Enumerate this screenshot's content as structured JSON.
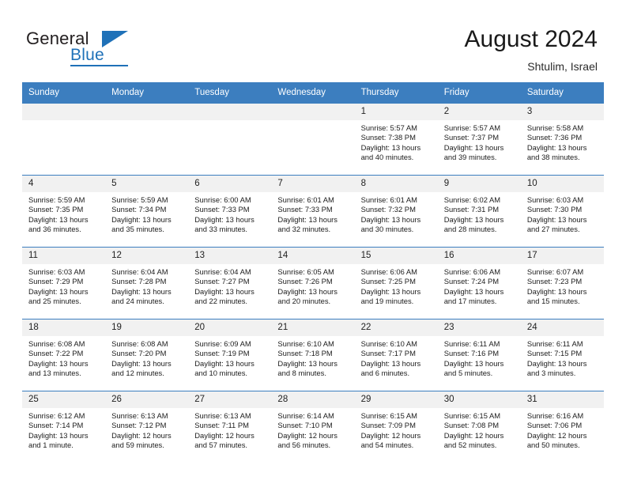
{
  "brand": {
    "name_part1": "General",
    "name_part2": "Blue",
    "accent_color": "#1f71b8"
  },
  "header": {
    "title": "August 2024",
    "location": "Shtulim, Israel"
  },
  "theme": {
    "header_row_color": "#3c7ebf",
    "daynum_bg": "#f1f1f1",
    "text_color": "#1c1c1c"
  },
  "weekdays": [
    "Sunday",
    "Monday",
    "Tuesday",
    "Wednesday",
    "Thursday",
    "Friday",
    "Saturday"
  ],
  "weeks": [
    [
      {
        "day": "",
        "blank": true
      },
      {
        "day": "",
        "blank": true
      },
      {
        "day": "",
        "blank": true
      },
      {
        "day": "",
        "blank": true
      },
      {
        "day": "1",
        "sunrise": "Sunrise: 5:57 AM",
        "sunset": "Sunset: 7:38 PM",
        "daylight_line1": "Daylight: 13 hours",
        "daylight_line2": "and 40 minutes."
      },
      {
        "day": "2",
        "sunrise": "Sunrise: 5:57 AM",
        "sunset": "Sunset: 7:37 PM",
        "daylight_line1": "Daylight: 13 hours",
        "daylight_line2": "and 39 minutes."
      },
      {
        "day": "3",
        "sunrise": "Sunrise: 5:58 AM",
        "sunset": "Sunset: 7:36 PM",
        "daylight_line1": "Daylight: 13 hours",
        "daylight_line2": "and 38 minutes."
      }
    ],
    [
      {
        "day": "4",
        "sunrise": "Sunrise: 5:59 AM",
        "sunset": "Sunset: 7:35 PM",
        "daylight_line1": "Daylight: 13 hours",
        "daylight_line2": "and 36 minutes."
      },
      {
        "day": "5",
        "sunrise": "Sunrise: 5:59 AM",
        "sunset": "Sunset: 7:34 PM",
        "daylight_line1": "Daylight: 13 hours",
        "daylight_line2": "and 35 minutes."
      },
      {
        "day": "6",
        "sunrise": "Sunrise: 6:00 AM",
        "sunset": "Sunset: 7:33 PM",
        "daylight_line1": "Daylight: 13 hours",
        "daylight_line2": "and 33 minutes."
      },
      {
        "day": "7",
        "sunrise": "Sunrise: 6:01 AM",
        "sunset": "Sunset: 7:33 PM",
        "daylight_line1": "Daylight: 13 hours",
        "daylight_line2": "and 32 minutes."
      },
      {
        "day": "8",
        "sunrise": "Sunrise: 6:01 AM",
        "sunset": "Sunset: 7:32 PM",
        "daylight_line1": "Daylight: 13 hours",
        "daylight_line2": "and 30 minutes."
      },
      {
        "day": "9",
        "sunrise": "Sunrise: 6:02 AM",
        "sunset": "Sunset: 7:31 PM",
        "daylight_line1": "Daylight: 13 hours",
        "daylight_line2": "and 28 minutes."
      },
      {
        "day": "10",
        "sunrise": "Sunrise: 6:03 AM",
        "sunset": "Sunset: 7:30 PM",
        "daylight_line1": "Daylight: 13 hours",
        "daylight_line2": "and 27 minutes."
      }
    ],
    [
      {
        "day": "11",
        "sunrise": "Sunrise: 6:03 AM",
        "sunset": "Sunset: 7:29 PM",
        "daylight_line1": "Daylight: 13 hours",
        "daylight_line2": "and 25 minutes."
      },
      {
        "day": "12",
        "sunrise": "Sunrise: 6:04 AM",
        "sunset": "Sunset: 7:28 PM",
        "daylight_line1": "Daylight: 13 hours",
        "daylight_line2": "and 24 minutes."
      },
      {
        "day": "13",
        "sunrise": "Sunrise: 6:04 AM",
        "sunset": "Sunset: 7:27 PM",
        "daylight_line1": "Daylight: 13 hours",
        "daylight_line2": "and 22 minutes."
      },
      {
        "day": "14",
        "sunrise": "Sunrise: 6:05 AM",
        "sunset": "Sunset: 7:26 PM",
        "daylight_line1": "Daylight: 13 hours",
        "daylight_line2": "and 20 minutes."
      },
      {
        "day": "15",
        "sunrise": "Sunrise: 6:06 AM",
        "sunset": "Sunset: 7:25 PM",
        "daylight_line1": "Daylight: 13 hours",
        "daylight_line2": "and 19 minutes."
      },
      {
        "day": "16",
        "sunrise": "Sunrise: 6:06 AM",
        "sunset": "Sunset: 7:24 PM",
        "daylight_line1": "Daylight: 13 hours",
        "daylight_line2": "and 17 minutes."
      },
      {
        "day": "17",
        "sunrise": "Sunrise: 6:07 AM",
        "sunset": "Sunset: 7:23 PM",
        "daylight_line1": "Daylight: 13 hours",
        "daylight_line2": "and 15 minutes."
      }
    ],
    [
      {
        "day": "18",
        "sunrise": "Sunrise: 6:08 AM",
        "sunset": "Sunset: 7:22 PM",
        "daylight_line1": "Daylight: 13 hours",
        "daylight_line2": "and 13 minutes."
      },
      {
        "day": "19",
        "sunrise": "Sunrise: 6:08 AM",
        "sunset": "Sunset: 7:20 PM",
        "daylight_line1": "Daylight: 13 hours",
        "daylight_line2": "and 12 minutes."
      },
      {
        "day": "20",
        "sunrise": "Sunrise: 6:09 AM",
        "sunset": "Sunset: 7:19 PM",
        "daylight_line1": "Daylight: 13 hours",
        "daylight_line2": "and 10 minutes."
      },
      {
        "day": "21",
        "sunrise": "Sunrise: 6:10 AM",
        "sunset": "Sunset: 7:18 PM",
        "daylight_line1": "Daylight: 13 hours",
        "daylight_line2": "and 8 minutes."
      },
      {
        "day": "22",
        "sunrise": "Sunrise: 6:10 AM",
        "sunset": "Sunset: 7:17 PM",
        "daylight_line1": "Daylight: 13 hours",
        "daylight_line2": "and 6 minutes."
      },
      {
        "day": "23",
        "sunrise": "Sunrise: 6:11 AM",
        "sunset": "Sunset: 7:16 PM",
        "daylight_line1": "Daylight: 13 hours",
        "daylight_line2": "and 5 minutes."
      },
      {
        "day": "24",
        "sunrise": "Sunrise: 6:11 AM",
        "sunset": "Sunset: 7:15 PM",
        "daylight_line1": "Daylight: 13 hours",
        "daylight_line2": "and 3 minutes."
      }
    ],
    [
      {
        "day": "25",
        "sunrise": "Sunrise: 6:12 AM",
        "sunset": "Sunset: 7:14 PM",
        "daylight_line1": "Daylight: 13 hours",
        "daylight_line2": "and 1 minute."
      },
      {
        "day": "26",
        "sunrise": "Sunrise: 6:13 AM",
        "sunset": "Sunset: 7:12 PM",
        "daylight_line1": "Daylight: 12 hours",
        "daylight_line2": "and 59 minutes."
      },
      {
        "day": "27",
        "sunrise": "Sunrise: 6:13 AM",
        "sunset": "Sunset: 7:11 PM",
        "daylight_line1": "Daylight: 12 hours",
        "daylight_line2": "and 57 minutes."
      },
      {
        "day": "28",
        "sunrise": "Sunrise: 6:14 AM",
        "sunset": "Sunset: 7:10 PM",
        "daylight_line1": "Daylight: 12 hours",
        "daylight_line2": "and 56 minutes."
      },
      {
        "day": "29",
        "sunrise": "Sunrise: 6:15 AM",
        "sunset": "Sunset: 7:09 PM",
        "daylight_line1": "Daylight: 12 hours",
        "daylight_line2": "and 54 minutes."
      },
      {
        "day": "30",
        "sunrise": "Sunrise: 6:15 AM",
        "sunset": "Sunset: 7:08 PM",
        "daylight_line1": "Daylight: 12 hours",
        "daylight_line2": "and 52 minutes."
      },
      {
        "day": "31",
        "sunrise": "Sunrise: 6:16 AM",
        "sunset": "Sunset: 7:06 PM",
        "daylight_line1": "Daylight: 12 hours",
        "daylight_line2": "and 50 minutes."
      }
    ]
  ]
}
